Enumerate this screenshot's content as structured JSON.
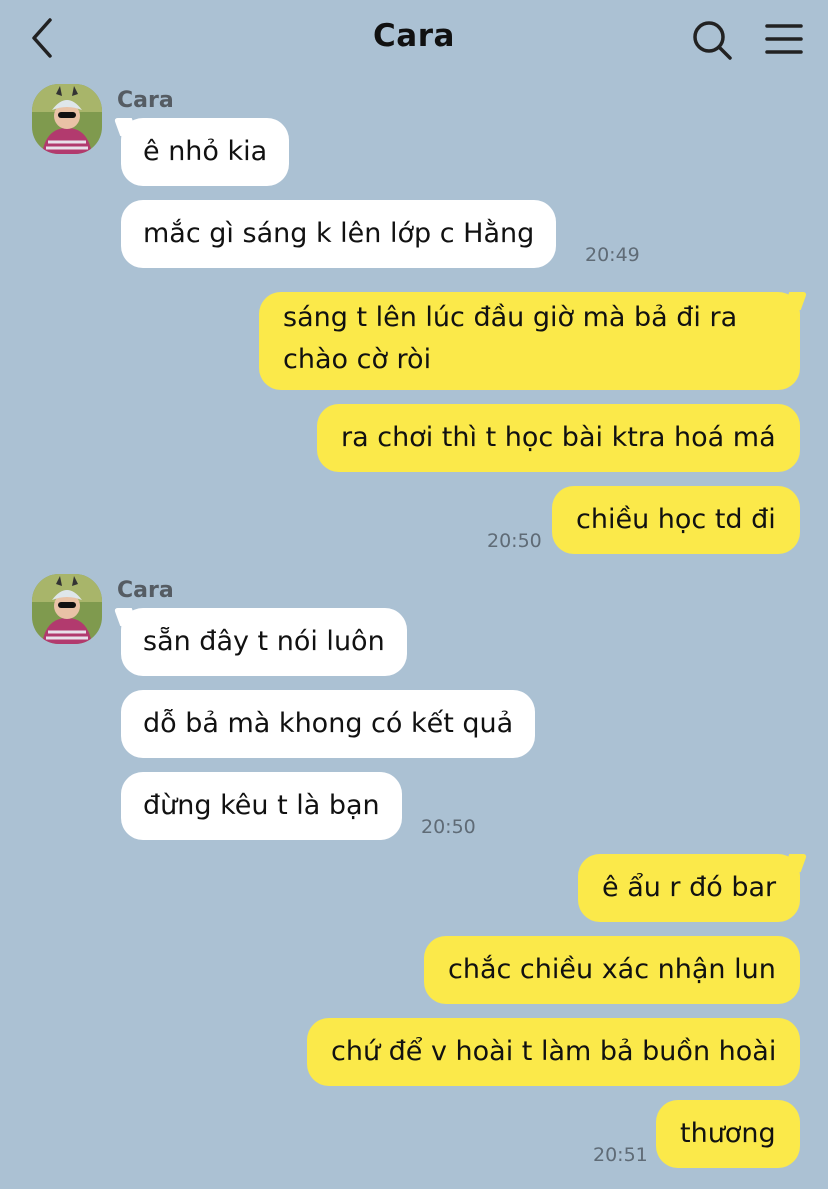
{
  "header": {
    "title": "Cara"
  },
  "messages": [
    {
      "sender": "Cara",
      "text": "ê nhỏ kia"
    },
    {
      "text": "mắc gì sáng k lên lớp c Hằng",
      "time": "20:49"
    },
    {
      "text": "sáng t lên lúc đầu giờ mà bả đi ra chào cờ ròi"
    },
    {
      "text": "ra chơi thì t học bài ktra hoá má"
    },
    {
      "text": "chiều học td đi",
      "time": "20:50"
    },
    {
      "sender": "Cara",
      "text": "sẵn đây t nói luôn"
    },
    {
      "text": "dỗ bả mà khong có kết quả"
    },
    {
      "text": "đừng kêu t là bạn",
      "time": "20:50"
    },
    {
      "text": "ê ẩu r đó bar"
    },
    {
      "text": "chắc chiều xác nhận lun"
    },
    {
      "text": "chứ để v hoài t làm bả buồn hoài"
    },
    {
      "text": "thương",
      "time": "20:51"
    }
  ],
  "colors": {
    "background": "#abc1d3",
    "incoming_bubble": "#ffffff",
    "outgoing_bubble": "#fbe94a"
  },
  "icons": [
    "back-chevron-icon",
    "search-icon",
    "hamburger-menu-icon"
  ]
}
